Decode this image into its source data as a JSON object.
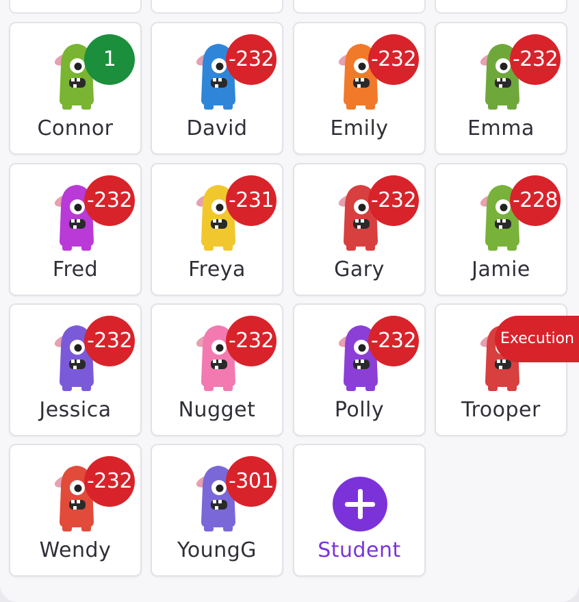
{
  "students": [
    {
      "name": "Connor",
      "points": "1",
      "badge_type": "positive",
      "avatar_color": "#7ab433"
    },
    {
      "name": "David",
      "points": "-232",
      "badge_type": "negative",
      "avatar_color": "#2f86d9"
    },
    {
      "name": "Emily",
      "points": "-232",
      "badge_type": "negative",
      "avatar_color": "#f07a2a"
    },
    {
      "name": "Emma",
      "points": "-232",
      "badge_type": "negative",
      "avatar_color": "#6ea83b"
    },
    {
      "name": "Fred",
      "points": "-232",
      "badge_type": "negative",
      "avatar_color": "#b93ad6"
    },
    {
      "name": "Freya",
      "points": "-231",
      "badge_type": "negative",
      "avatar_color": "#f1c72e"
    },
    {
      "name": "Gary",
      "points": "-232",
      "badge_type": "negative",
      "avatar_color": "#d83f3f"
    },
    {
      "name": "Jamie",
      "points": "-228",
      "badge_type": "negative",
      "avatar_color": "#78b23a"
    },
    {
      "name": "Jessica",
      "points": "-232",
      "badge_type": "negative",
      "avatar_color": "#7a5ad8"
    },
    {
      "name": "Nugget",
      "points": "-232",
      "badge_type": "negative",
      "avatar_color": "#f27ab0"
    },
    {
      "name": "Polly",
      "points": "-232",
      "badge_type": "negative",
      "avatar_color": "#8b3fd6"
    },
    {
      "name": "Trooper",
      "points": "Execution",
      "badge_type": "execution",
      "avatar_color": "#d83f3f"
    },
    {
      "name": "Wendy",
      "points": "-232",
      "badge_type": "negative",
      "avatar_color": "#e24a3a"
    },
    {
      "name": "YoungG",
      "points": "-301",
      "badge_type": "negative",
      "avatar_color": "#7a68d8"
    }
  ],
  "add_student": {
    "label": "Student"
  },
  "colors": {
    "negative_badge": "#d8232b",
    "positive_badge": "#1c8f3c",
    "add_accent": "#7b33d9"
  }
}
